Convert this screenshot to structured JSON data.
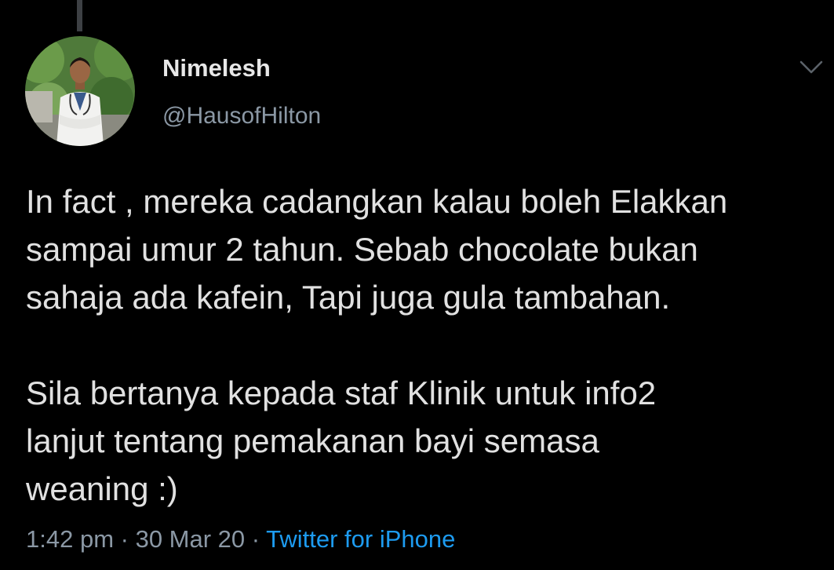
{
  "author": {
    "display_name": "Nimelesh",
    "handle": "@HausofHilton"
  },
  "tweet": {
    "paragraph_1_lines": [
      "In fact , mereka cadangkan kalau boleh Elakkan",
      "sampai umur 2 tahun. Sebab chocolate bukan",
      "sahaja ada kafein, Tapi juga gula tambahan."
    ],
    "paragraph_2_lines": [
      "Sila bertanya kepada staf Klinik untuk info2",
      "lanjut tentang pemakanan bayi semasa",
      "weaning :)"
    ]
  },
  "meta": {
    "time": "1:42 pm",
    "separator_1": " · ",
    "date": "30 Mar 20",
    "separator_2": " · ",
    "source": "Twitter for iPhone"
  },
  "colors": {
    "background": "#000000",
    "primary_text": "#e1e1e1",
    "secondary_text": "#8b98a5",
    "link": "#1d9bf0"
  },
  "icons": {
    "more": "chevron-down-icon"
  }
}
